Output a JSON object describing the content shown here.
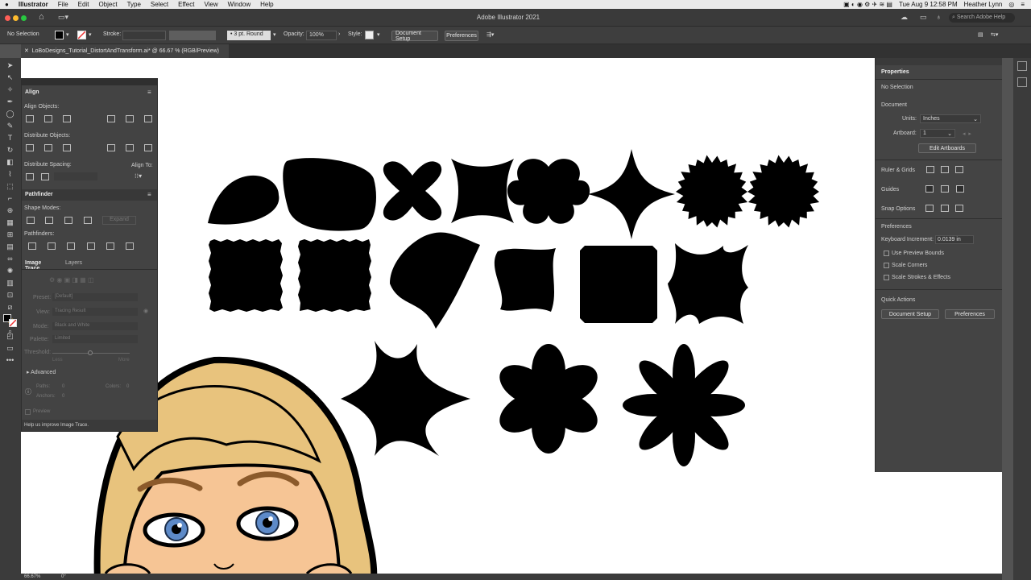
{
  "menubar": {
    "apple": "",
    "app": "Illustrator",
    "items": [
      "File",
      "Edit",
      "Object",
      "Type",
      "Select",
      "Effect",
      "View",
      "Window",
      "Help"
    ],
    "datetime": "Tue Aug 9  12:58 PM",
    "user": "Heather Lynn"
  },
  "titlebar": {
    "title": "Adobe Illustrator 2021",
    "search_placeholder": "Search Adobe Help"
  },
  "control": {
    "selection": "No Selection",
    "stroke_label": "Stroke:",
    "brush": "3 pt. Round",
    "opacity_label": "Opacity:",
    "opacity_value": "100%",
    "style_label": "Style:",
    "doc_setup": "Document Setup",
    "preferences": "Preferences"
  },
  "document": {
    "tab_title": "LoBoDesigns_Tutorial_DistortAndTransform.ai* @ 66.67 % (RGB/Preview)",
    "zoom": "66.67%",
    "rotation": "0°"
  },
  "align_panel": {
    "tab": "Align",
    "align_objects": "Align Objects:",
    "distribute_objects": "Distribute Objects:",
    "distribute_spacing": "Distribute Spacing:",
    "align_to": "Align To:"
  },
  "pathfinder_panel": {
    "tab": "Pathfinder",
    "shape_modes": "Shape Modes:",
    "expand": "Expand",
    "pathfinders": "Pathfinders:"
  },
  "trace_panel": {
    "tabs": [
      "Image Trace",
      "Layers"
    ],
    "preset_label": "Preset:",
    "preset_value": "[Default]",
    "view_label": "View:",
    "view_value": "Tracing Result",
    "mode_label": "Mode:",
    "mode_value": "Black and White",
    "palette_label": "Palette:",
    "palette_value": "Limited",
    "threshold_label": "Threshold:",
    "less": "Less",
    "more": "More",
    "advanced": "Advanced",
    "paths_label": "Paths:",
    "paths_value": "0",
    "colors_label": "Colors:",
    "colors_value": "0",
    "anchors_label": "Anchors:",
    "anchors_value": "0",
    "preview": "Preview",
    "help": "Help us improve Image Trace."
  },
  "properties": {
    "title": "Properties",
    "no_selection": "No Selection",
    "document": "Document",
    "units_label": "Units:",
    "units_value": "Inches",
    "artboard_label": "Artboard:",
    "artboard_value": "1",
    "edit_artboards": "Edit Artboards",
    "ruler_grids": "Ruler & Grids",
    "guides": "Guides",
    "snap_options": "Snap Options",
    "preferences": "Preferences",
    "keyboard_inc_label": "Keyboard Increment:",
    "keyboard_inc_value": "0.0139 in",
    "use_preview_bounds": "Use Preview Bounds",
    "scale_corners": "Scale Corners",
    "scale_strokes": "Scale Strokes & Effects",
    "quick_actions": "Quick Actions",
    "doc_setup": "Document Setup",
    "prefs_btn": "Preferences"
  },
  "colors": {
    "accent": "#2f7be5",
    "panel": "#444444",
    "canvas": "#ffffff",
    "shape": "#000000"
  }
}
